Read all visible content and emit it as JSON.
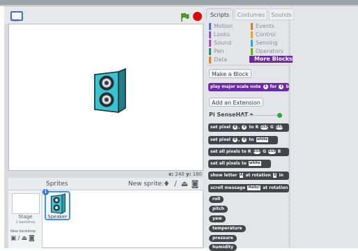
{
  "stage": {
    "layout_label": "Full",
    "coords": {
      "x_label": "x:",
      "x_value": "240",
      "y_label": "y:",
      "y_value": "180"
    }
  },
  "sprites": {
    "title": "Sprites",
    "new_sprite_label": "New sprite:",
    "new_sprite_icons": [
      "sprite-library-icon",
      "paint-brush-icon",
      "upload-icon",
      "camera-icon"
    ],
    "stage_label": "Stage",
    "backdrop_count": "1 backdrop",
    "new_backdrop_label": "New backdrop:",
    "new_backdrop_icons": [
      "library-icon",
      "paint-icon",
      "upload-icon",
      "camera-icon"
    ],
    "items": [
      {
        "name": "Speaker"
      }
    ]
  },
  "tabs": [
    {
      "label": "Scripts",
      "active": true
    },
    {
      "label": "Costumes",
      "active": false
    },
    {
      "label": "Sounds",
      "active": false
    }
  ],
  "categories": [
    {
      "label": "Motion",
      "color": "#4a6cd4"
    },
    {
      "label": "Events",
      "color": "#c88330"
    },
    {
      "label": "Looks",
      "color": "#8a55d7"
    },
    {
      "label": "Control",
      "color": "#e1a91a"
    },
    {
      "label": "Sound",
      "color": "#bb42c3"
    },
    {
      "label": "Sensing",
      "color": "#2ca5e2"
    },
    {
      "label": "Pen",
      "color": "#0e9a6c"
    },
    {
      "label": "Operators",
      "color": "#5cb712"
    },
    {
      "label": "Data",
      "color": "#ee7d16"
    },
    {
      "label": "More Blocks",
      "color": "#632d99"
    }
  ],
  "palette": {
    "make_block_label": "Make a Block",
    "play_block": {
      "text": "play major scale note",
      "num1": "1",
      "mid": "for",
      "num2": "1",
      "tail": "b"
    },
    "add_extension_label": "Add an Extension",
    "extension_title": "Pi SenseHAT ▾",
    "blocks": [
      {
        "pre": "set pixel",
        "a": "0",
        "b": "0",
        "mid": "to R",
        "r": "255",
        "g_label": "G",
        "g": "255"
      },
      {
        "pre": "set pixel",
        "a": "0",
        "b": "0",
        "mid": "to",
        "txt": "white"
      },
      {
        "pre": "set all pixels to R",
        "r": "255",
        "g_label": "G",
        "g": "255",
        "b_label": "B"
      },
      {
        "pre": "set all pixels to",
        "txt": "white"
      },
      {
        "pre": "show letter",
        "txt": "A",
        "mid": "at rotation",
        "num": "0",
        "tail": "in"
      },
      {
        "pre": "scroll message",
        "txt": "Hello!",
        "mid": "at rotation"
      }
    ],
    "reporters": [
      "roll",
      "pitch",
      "yaw",
      "temperature",
      "pressure",
      "humidity"
    ]
  }
}
